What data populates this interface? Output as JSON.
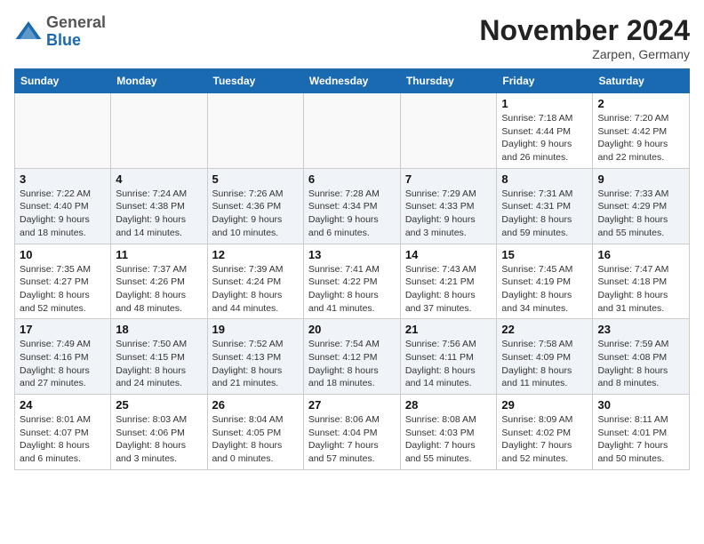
{
  "header": {
    "logo_general": "General",
    "logo_blue": "Blue",
    "month_title": "November 2024",
    "location": "Zarpen, Germany"
  },
  "days_of_week": [
    "Sunday",
    "Monday",
    "Tuesday",
    "Wednesday",
    "Thursday",
    "Friday",
    "Saturday"
  ],
  "weeks": [
    [
      {
        "day": "",
        "info": ""
      },
      {
        "day": "",
        "info": ""
      },
      {
        "day": "",
        "info": ""
      },
      {
        "day": "",
        "info": ""
      },
      {
        "day": "",
        "info": ""
      },
      {
        "day": "1",
        "info": "Sunrise: 7:18 AM\nSunset: 4:44 PM\nDaylight: 9 hours and 26 minutes."
      },
      {
        "day": "2",
        "info": "Sunrise: 7:20 AM\nSunset: 4:42 PM\nDaylight: 9 hours and 22 minutes."
      }
    ],
    [
      {
        "day": "3",
        "info": "Sunrise: 7:22 AM\nSunset: 4:40 PM\nDaylight: 9 hours and 18 minutes."
      },
      {
        "day": "4",
        "info": "Sunrise: 7:24 AM\nSunset: 4:38 PM\nDaylight: 9 hours and 14 minutes."
      },
      {
        "day": "5",
        "info": "Sunrise: 7:26 AM\nSunset: 4:36 PM\nDaylight: 9 hours and 10 minutes."
      },
      {
        "day": "6",
        "info": "Sunrise: 7:28 AM\nSunset: 4:34 PM\nDaylight: 9 hours and 6 minutes."
      },
      {
        "day": "7",
        "info": "Sunrise: 7:29 AM\nSunset: 4:33 PM\nDaylight: 9 hours and 3 minutes."
      },
      {
        "day": "8",
        "info": "Sunrise: 7:31 AM\nSunset: 4:31 PM\nDaylight: 8 hours and 59 minutes."
      },
      {
        "day": "9",
        "info": "Sunrise: 7:33 AM\nSunset: 4:29 PM\nDaylight: 8 hours and 55 minutes."
      }
    ],
    [
      {
        "day": "10",
        "info": "Sunrise: 7:35 AM\nSunset: 4:27 PM\nDaylight: 8 hours and 52 minutes."
      },
      {
        "day": "11",
        "info": "Sunrise: 7:37 AM\nSunset: 4:26 PM\nDaylight: 8 hours and 48 minutes."
      },
      {
        "day": "12",
        "info": "Sunrise: 7:39 AM\nSunset: 4:24 PM\nDaylight: 8 hours and 44 minutes."
      },
      {
        "day": "13",
        "info": "Sunrise: 7:41 AM\nSunset: 4:22 PM\nDaylight: 8 hours and 41 minutes."
      },
      {
        "day": "14",
        "info": "Sunrise: 7:43 AM\nSunset: 4:21 PM\nDaylight: 8 hours and 37 minutes."
      },
      {
        "day": "15",
        "info": "Sunrise: 7:45 AM\nSunset: 4:19 PM\nDaylight: 8 hours and 34 minutes."
      },
      {
        "day": "16",
        "info": "Sunrise: 7:47 AM\nSunset: 4:18 PM\nDaylight: 8 hours and 31 minutes."
      }
    ],
    [
      {
        "day": "17",
        "info": "Sunrise: 7:49 AM\nSunset: 4:16 PM\nDaylight: 8 hours and 27 minutes."
      },
      {
        "day": "18",
        "info": "Sunrise: 7:50 AM\nSunset: 4:15 PM\nDaylight: 8 hours and 24 minutes."
      },
      {
        "day": "19",
        "info": "Sunrise: 7:52 AM\nSunset: 4:13 PM\nDaylight: 8 hours and 21 minutes."
      },
      {
        "day": "20",
        "info": "Sunrise: 7:54 AM\nSunset: 4:12 PM\nDaylight: 8 hours and 18 minutes."
      },
      {
        "day": "21",
        "info": "Sunrise: 7:56 AM\nSunset: 4:11 PM\nDaylight: 8 hours and 14 minutes."
      },
      {
        "day": "22",
        "info": "Sunrise: 7:58 AM\nSunset: 4:09 PM\nDaylight: 8 hours and 11 minutes."
      },
      {
        "day": "23",
        "info": "Sunrise: 7:59 AM\nSunset: 4:08 PM\nDaylight: 8 hours and 8 minutes."
      }
    ],
    [
      {
        "day": "24",
        "info": "Sunrise: 8:01 AM\nSunset: 4:07 PM\nDaylight: 8 hours and 6 minutes."
      },
      {
        "day": "25",
        "info": "Sunrise: 8:03 AM\nSunset: 4:06 PM\nDaylight: 8 hours and 3 minutes."
      },
      {
        "day": "26",
        "info": "Sunrise: 8:04 AM\nSunset: 4:05 PM\nDaylight: 8 hours and 0 minutes."
      },
      {
        "day": "27",
        "info": "Sunrise: 8:06 AM\nSunset: 4:04 PM\nDaylight: 7 hours and 57 minutes."
      },
      {
        "day": "28",
        "info": "Sunrise: 8:08 AM\nSunset: 4:03 PM\nDaylight: 7 hours and 55 minutes."
      },
      {
        "day": "29",
        "info": "Sunrise: 8:09 AM\nSunset: 4:02 PM\nDaylight: 7 hours and 52 minutes."
      },
      {
        "day": "30",
        "info": "Sunrise: 8:11 AM\nSunset: 4:01 PM\nDaylight: 7 hours and 50 minutes."
      }
    ]
  ]
}
